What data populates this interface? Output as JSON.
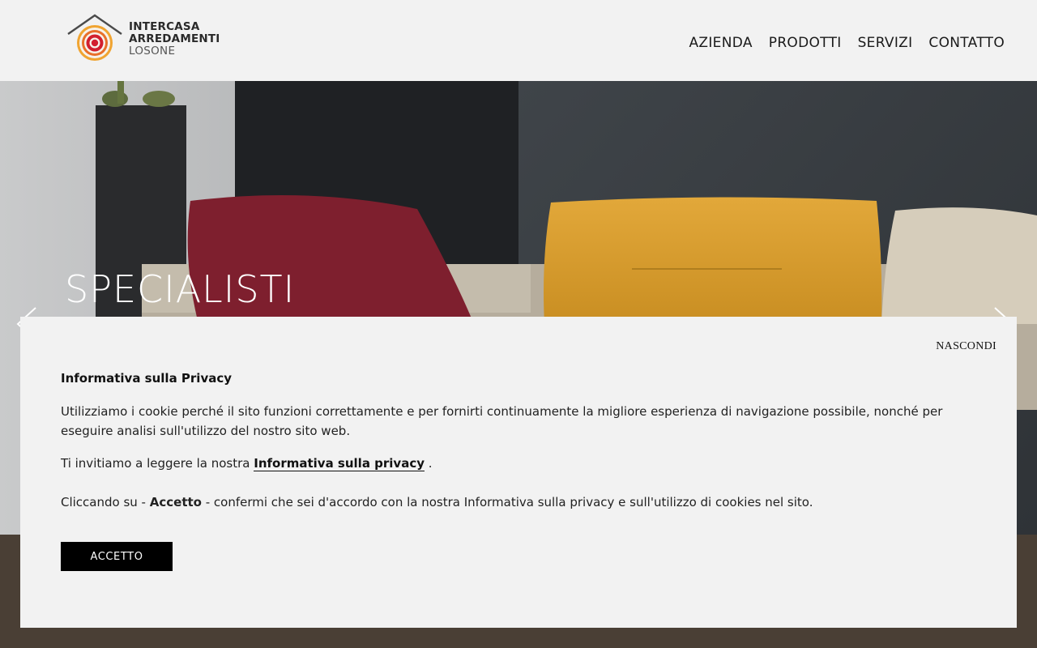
{
  "logo": {
    "line1": "INTERCASA",
    "line2": "ARREDAMENTI",
    "line3": "LOSONE",
    "colors": {
      "outer": "#f0a431",
      "middle": "#e8702a",
      "inner": "#d21f2e",
      "roof": "#4a4a4a"
    }
  },
  "nav": {
    "items": [
      {
        "label": "AZIENDA"
      },
      {
        "label": "PRODOTTI"
      },
      {
        "label": "SERVIZI"
      },
      {
        "label": "CONTATTO"
      }
    ]
  },
  "hero": {
    "title": "SPECIALISTI",
    "prev_icon": "chevron-left-icon",
    "next_icon": "chevron-right-icon"
  },
  "cookie": {
    "hide_label": "NASCONDI",
    "title": "Informativa sulla Privacy",
    "paragraph1": "Utilizziamo i cookie perché il sito funzioni correttamente e per fornirti continuamente la migliore esperienza di navigazione possibile, nonché per eseguire analisi sull'utilizzo del nostro sito web.",
    "paragraph2_prefix": "Ti invitiamo a leggere la nostra ",
    "paragraph2_link": "Informativa sulla privacy",
    "paragraph2_suffix": " .",
    "paragraph3_prefix": "Cliccando su - ",
    "paragraph3_bold": "Accetto",
    "paragraph3_suffix": " - confermi che sei d'accordo con la nostra Informativa sulla privacy e sull'utilizzo di cookies nel sito.",
    "accept_label": "ACCETTO"
  }
}
